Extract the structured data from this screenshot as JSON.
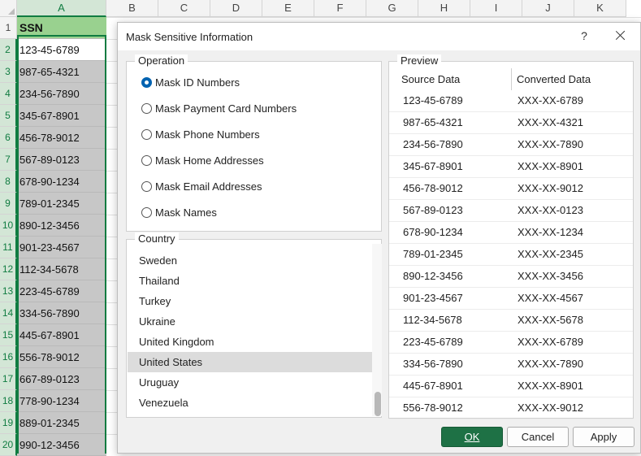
{
  "sheet": {
    "columns": [
      "A",
      "B",
      "C",
      "D",
      "E",
      "F",
      "G",
      "H",
      "I",
      "J",
      "K"
    ],
    "rows": [
      "1",
      "2",
      "3",
      "4",
      "5",
      "6",
      "7",
      "8",
      "9",
      "10",
      "11",
      "12",
      "13",
      "14",
      "15",
      "16",
      "17",
      "18",
      "19",
      "20"
    ],
    "colA": [
      "SSN",
      "123-45-6789",
      "987-65-4321",
      "234-56-7890",
      "345-67-8901",
      "456-78-9012",
      "567-89-0123",
      "678-90-1234",
      "789-01-2345",
      "890-12-3456",
      "901-23-4567",
      "112-34-5678",
      "223-45-6789",
      "334-56-7890",
      "445-67-8901",
      "556-78-9012",
      "667-89-0123",
      "778-90-1234",
      "889-01-2345",
      "990-12-3456"
    ],
    "header_color": "#99d18f",
    "accent": "#107c41"
  },
  "dialog": {
    "title": "Mask Sensitive Information",
    "help": "?",
    "operation_label": "Operation",
    "options": [
      {
        "label": "Mask ID Numbers",
        "checked": true
      },
      {
        "label": "Mask Payment Card Numbers",
        "checked": false
      },
      {
        "label": "Mask Phone Numbers",
        "checked": false
      },
      {
        "label": "Mask Home Addresses",
        "checked": false
      },
      {
        "label": "Mask Email Addresses",
        "checked": false
      },
      {
        "label": "Mask Names",
        "checked": false
      }
    ],
    "country_label": "Country",
    "countries": [
      "Sweden",
      "Thailand",
      "Turkey",
      "Ukraine",
      "United Kingdom",
      "United States",
      "Uruguay",
      "Venezuela"
    ],
    "selected_country": "United States",
    "preview_label": "Preview",
    "preview_headers": [
      "Source Data",
      "Converted Data"
    ],
    "preview_rows": [
      [
        "123-45-6789",
        "XXX-XX-6789"
      ],
      [
        "987-65-4321",
        "XXX-XX-4321"
      ],
      [
        "234-56-7890",
        "XXX-XX-7890"
      ],
      [
        "345-67-8901",
        "XXX-XX-8901"
      ],
      [
        "456-78-9012",
        "XXX-XX-9012"
      ],
      [
        "567-89-0123",
        "XXX-XX-0123"
      ],
      [
        "678-90-1234",
        "XXX-XX-1234"
      ],
      [
        "789-01-2345",
        "XXX-XX-2345"
      ],
      [
        "890-12-3456",
        "XXX-XX-3456"
      ],
      [
        "901-23-4567",
        "XXX-XX-4567"
      ],
      [
        "112-34-5678",
        "XXX-XX-5678"
      ],
      [
        "223-45-6789",
        "XXX-XX-6789"
      ],
      [
        "334-56-7890",
        "XXX-XX-7890"
      ],
      [
        "445-67-8901",
        "XXX-XX-8901"
      ],
      [
        "556-78-9012",
        "XXX-XX-9012"
      ]
    ],
    "buttons": {
      "ok": "OK",
      "cancel": "Cancel",
      "apply": "Apply"
    },
    "ok_color": "#1e7145"
  }
}
